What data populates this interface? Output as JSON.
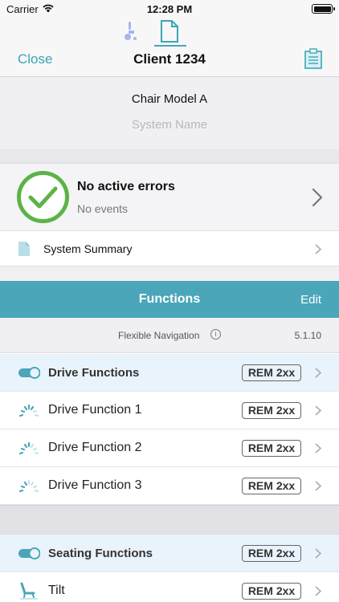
{
  "status_bar": {
    "carrier": "Carrier",
    "time": "12:28 PM"
  },
  "nav": {
    "segments": [
      "wheelchair-icon",
      "document-icon"
    ],
    "close_label": "Close",
    "title": "Client 1234",
    "accent_color": "#3aa7b5"
  },
  "system": {
    "chair_model": "Chair Model A",
    "system_name_placeholder": "System Name"
  },
  "errors": {
    "title": "No active errors",
    "subtitle": "No events",
    "status_color": "#5cb346"
  },
  "summary": {
    "label": "System Summary"
  },
  "functions": {
    "title": "Functions",
    "edit_label": "Edit",
    "header_color": "#4aa6b8",
    "flex_nav_label": "Flexible Navigation",
    "version": "5.1.10"
  },
  "rows": [
    {
      "label": "Drive Functions",
      "badge": "REM 2xx",
      "icon": "toggle-icon",
      "group": true
    },
    {
      "label": "Drive Function 1",
      "badge": "REM 2xx",
      "icon": "speed-gauge-icon",
      "group": false
    },
    {
      "label": "Drive Function 2",
      "badge": "REM 2xx",
      "icon": "speed-gauge-icon",
      "group": false
    },
    {
      "label": "Drive Function 3",
      "badge": "REM 2xx",
      "icon": "speed-gauge-icon",
      "group": false
    },
    {
      "label": "Seating Functions",
      "badge": "REM 2xx",
      "icon": "toggle-icon",
      "group": true
    },
    {
      "label": "Tilt",
      "badge": "REM 2xx",
      "icon": "seat-tilt-icon",
      "group": false
    }
  ]
}
